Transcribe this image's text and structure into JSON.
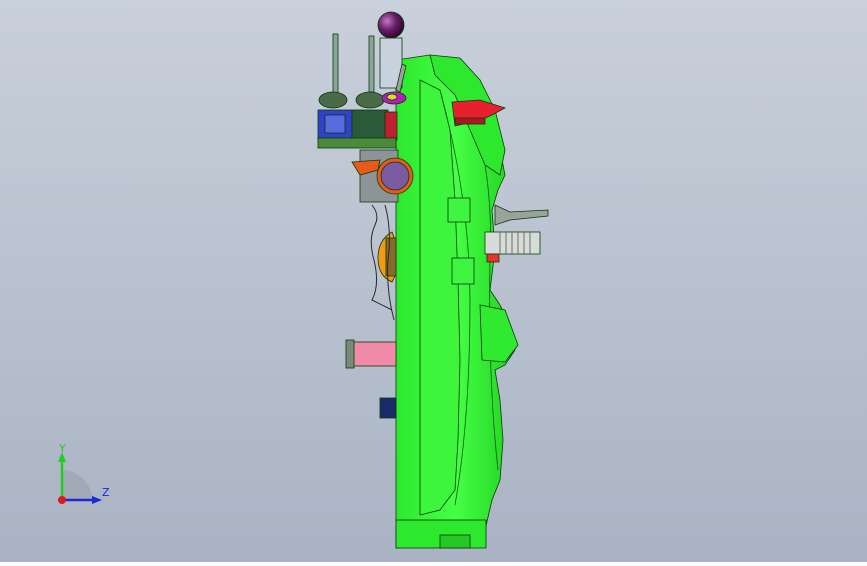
{
  "viewport": {
    "background_top": "#c9d0db",
    "background_bottom": "#a9b3c3"
  },
  "model": {
    "body_color": "#33ff33",
    "body_shade": "#1fcc1f",
    "edge_color": "#0a3a0a"
  },
  "triad": {
    "y_label": "Y",
    "z_label": "Z",
    "y_color": "#22cc22",
    "z_color": "#1a2bd6",
    "x_color": "#d91a1a"
  }
}
